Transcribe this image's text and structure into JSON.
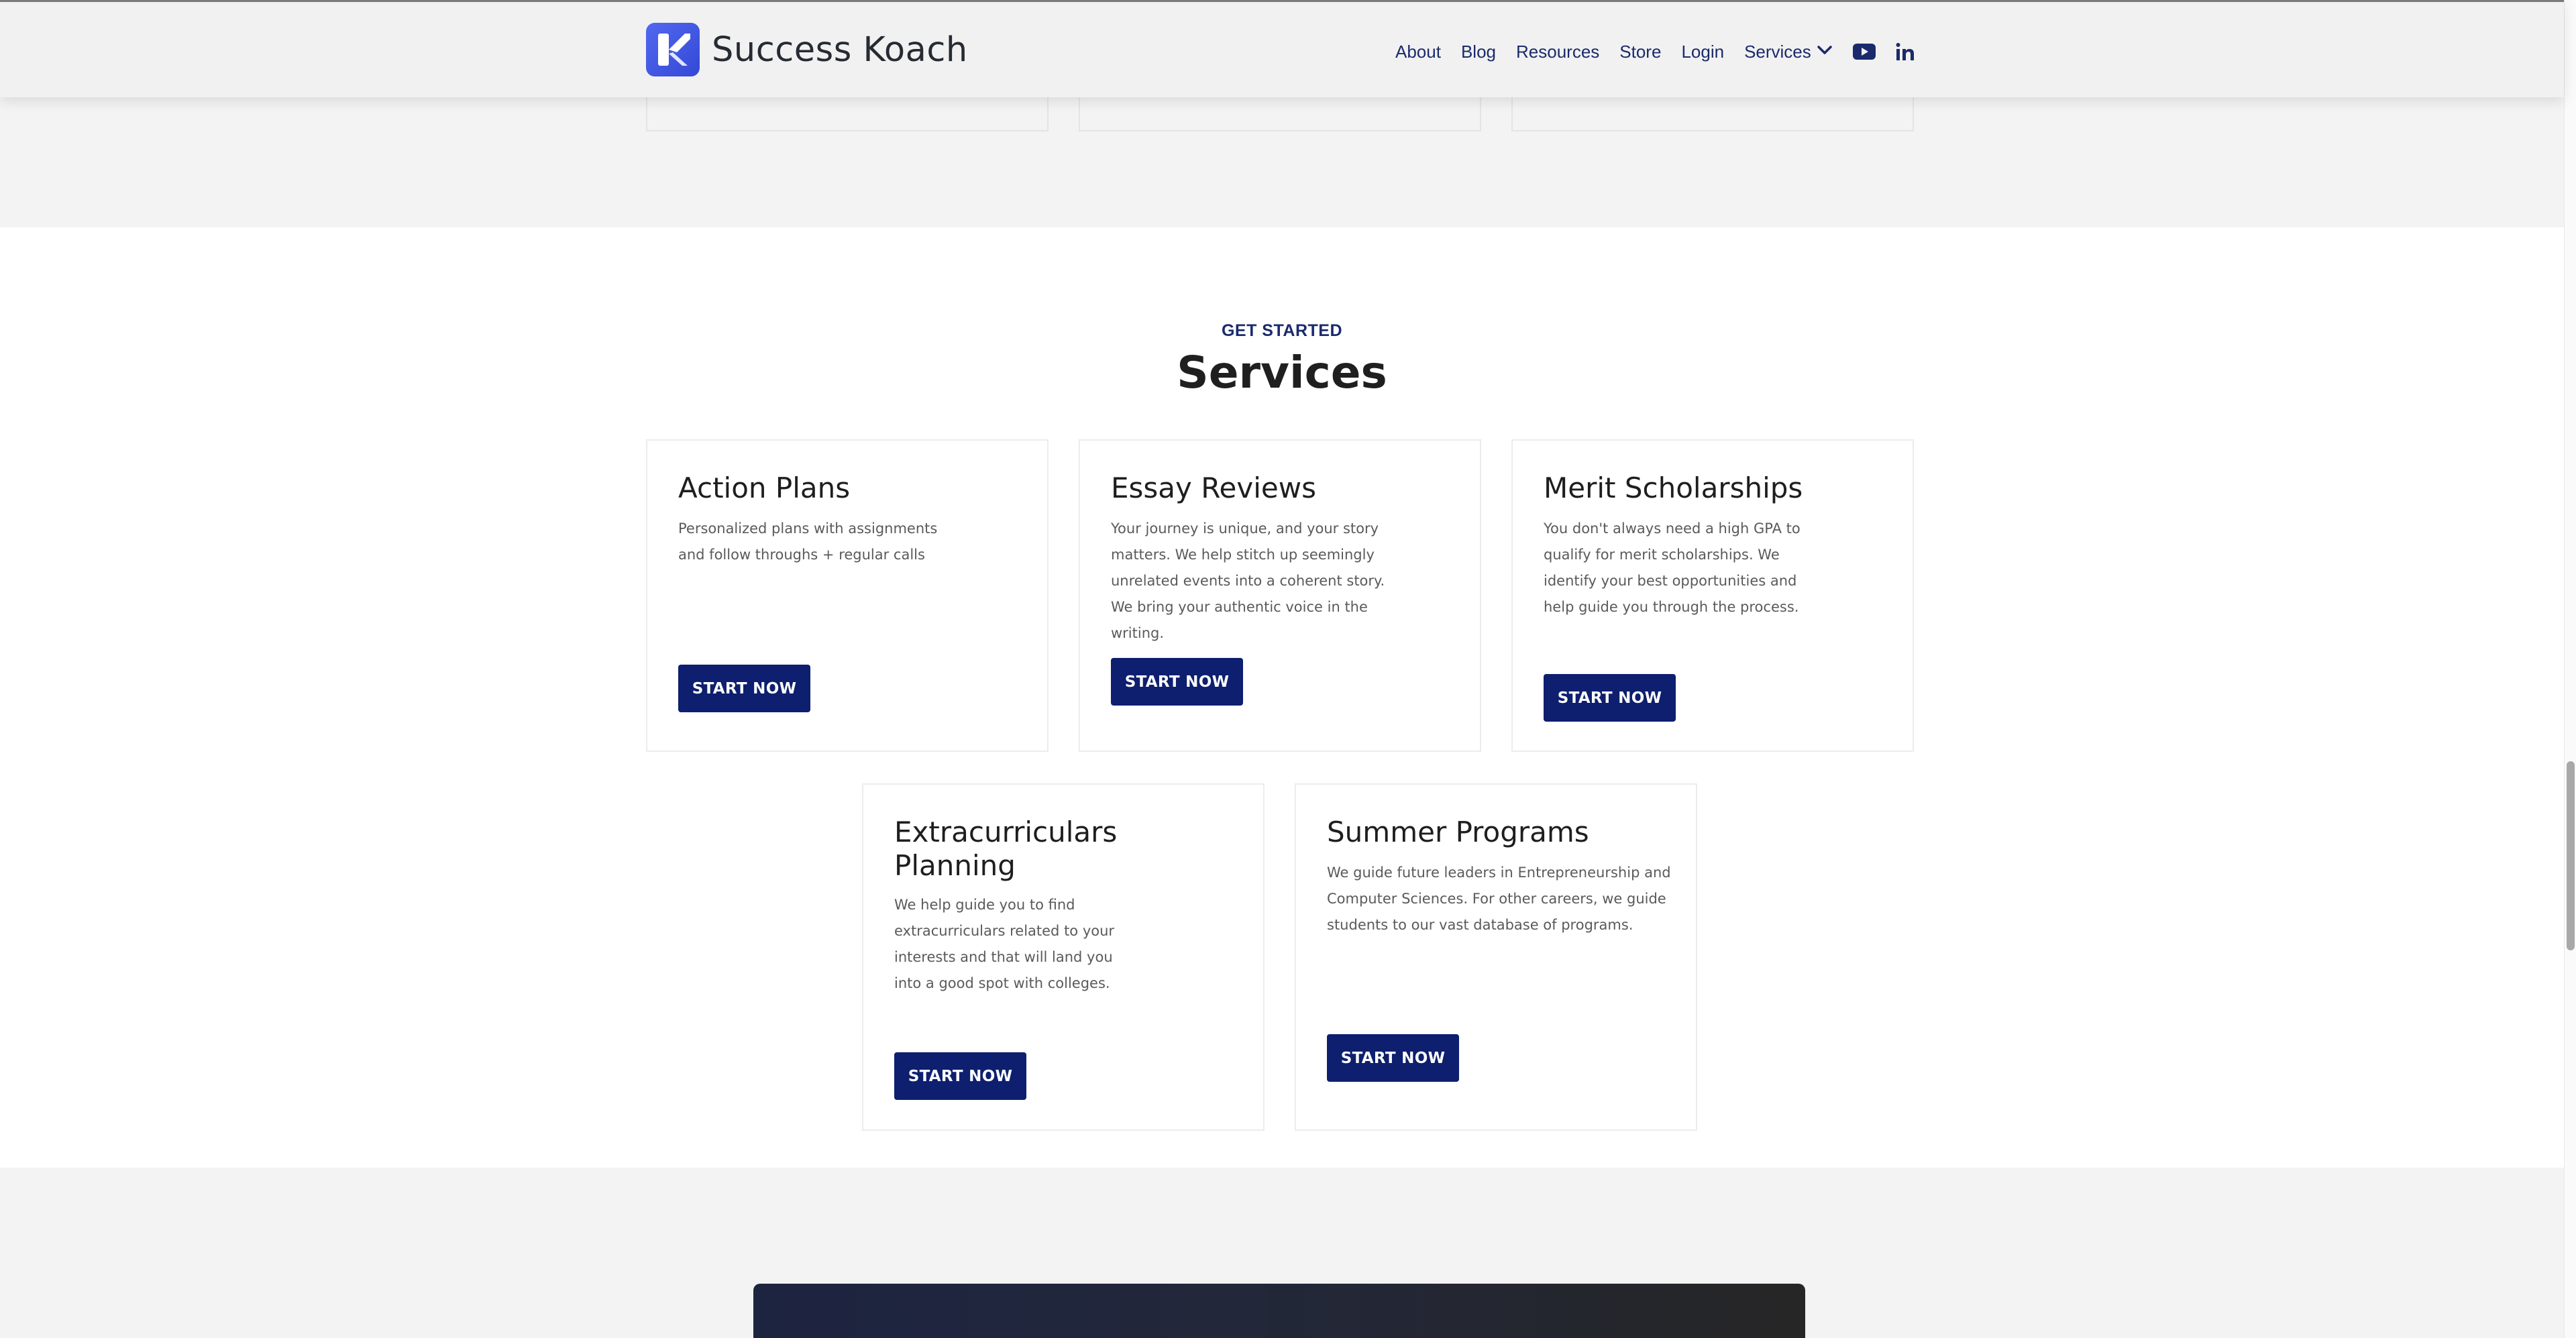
{
  "brand": {
    "name": "Success Koach",
    "accent": "#0d1f6e",
    "logo_color": "#4a5ee8"
  },
  "nav": {
    "about": "About",
    "blog": "Blog",
    "resources": "Resources",
    "store": "Store",
    "login": "Login",
    "services": "Services",
    "icons": [
      "chevron-down-icon",
      "youtube-icon",
      "linkedin-icon"
    ]
  },
  "services": {
    "eyebrow": "GET STARTED",
    "title": "Services",
    "cards": [
      {
        "title": "Action Plans",
        "desc_lines": [
          "Personalized plans with assignments",
          "and follow throughs + regular calls"
        ],
        "cta": "START NOW"
      },
      {
        "title": "Essay Reviews",
        "desc_lines": [
          "Your journey is unique, and your story",
          "matters. We help stitch up seemingly",
          "unrelated events into a coherent story.",
          "We bring your authentic voice in the",
          "writing."
        ],
        "cta": "START NOW"
      },
      {
        "title": "Merit Scholarships",
        "desc_lines": [
          "You don't always need a high GPA to",
          "qualify for merit scholarships. We",
          "identify your best opportunities and",
          "help guide you through the process."
        ],
        "cta": "START NOW"
      },
      {
        "title_lines": [
          "Extracurriculars",
          "Planning"
        ],
        "desc_lines": [
          "We help guide you to find",
          "extracurriculars related to your",
          "interests and that will land you",
          "into a good spot with colleges."
        ],
        "cta": "START NOW"
      },
      {
        "title": "Summer Programs",
        "desc_lines": [
          "We guide future leaders in Entrepreneurship and",
          "Computer Sciences. For other careers, we guide",
          "students to our vast database of programs."
        ],
        "cta": "START NOW"
      }
    ]
  }
}
